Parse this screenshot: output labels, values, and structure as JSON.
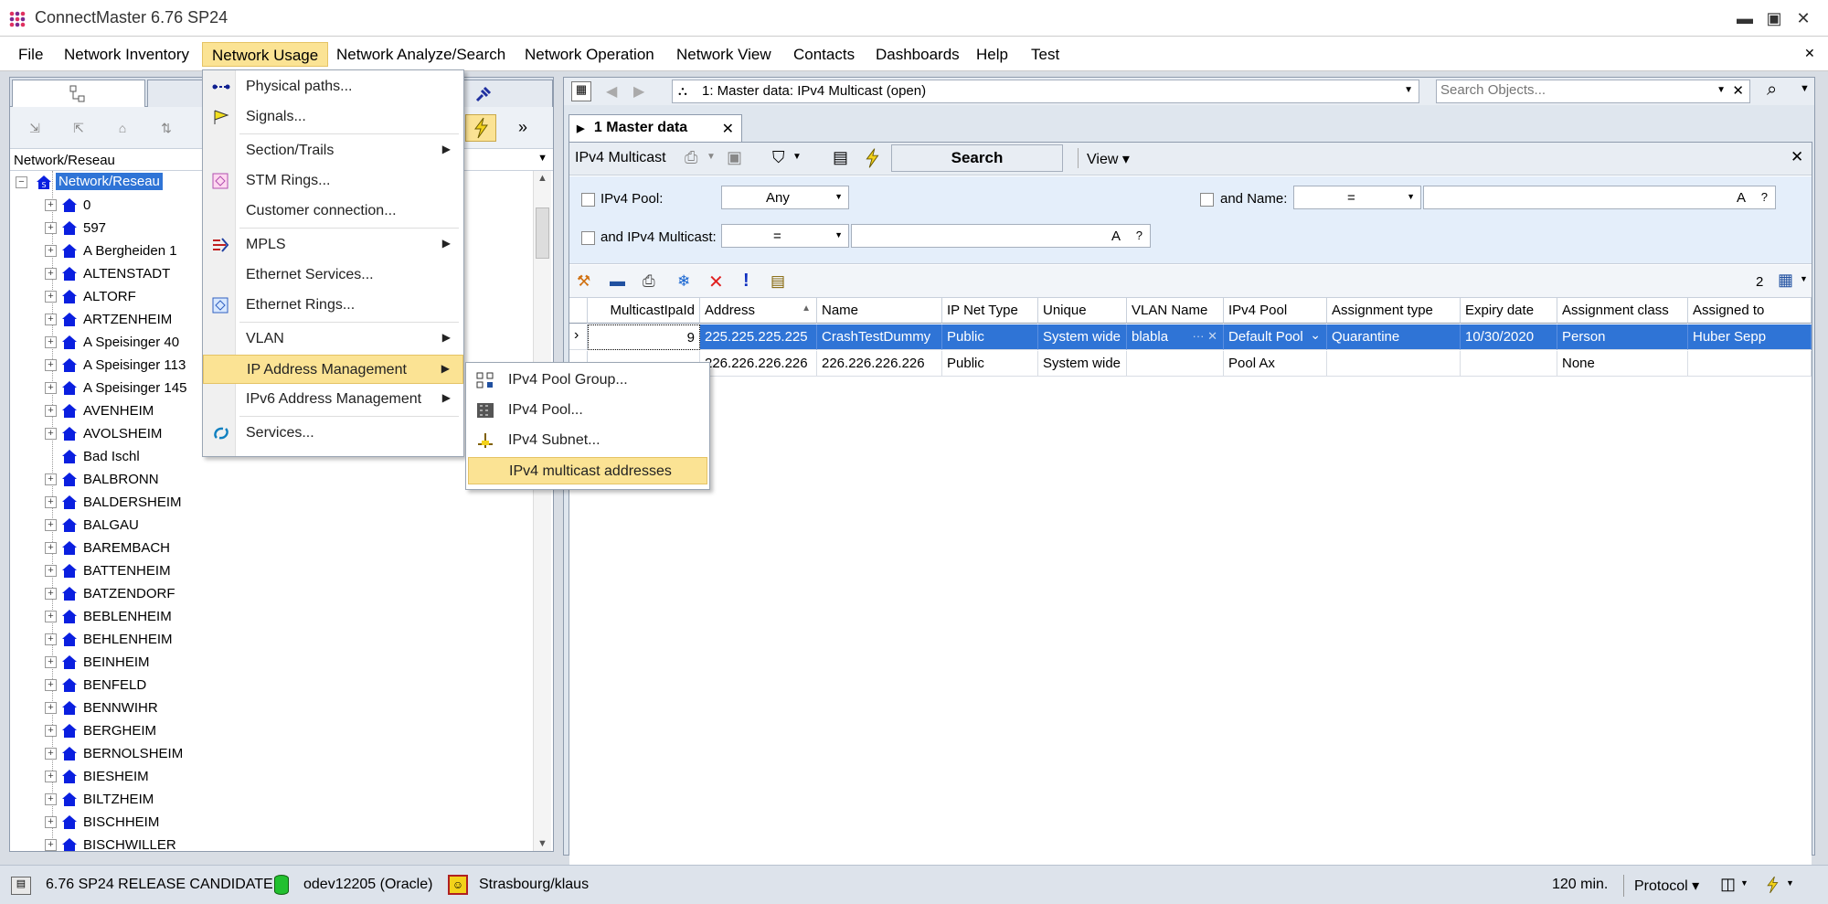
{
  "window": {
    "title": "ConnectMaster 6.76 SP24",
    "minimize": "▬",
    "maximize": "▣",
    "close": "✕"
  },
  "menu": [
    "File",
    "Network Inventory",
    "Network Usage",
    "Network Analyze/Search",
    "Network Operation",
    "Network View",
    "Contacts",
    "Dashboards",
    "Help",
    "Test"
  ],
  "menu_close": "✕",
  "left": {
    "path": "Network/Reseau",
    "more": "»",
    "tree_root": "Network/Reseau",
    "tree": [
      "0",
      "597",
      "A Bergheiden 1",
      "ALTENSTADT",
      "ALTORF",
      "ARTZENHEIM",
      "A Speisinger 40",
      "A Speisinger 113",
      "A Speisinger 145",
      "AVENHEIM",
      "AVOLSHEIM",
      "Bad Ischl",
      "BALBRONN",
      "BALDERSHEIM",
      "BALGAU",
      "BAREMBACH",
      "BATTENHEIM",
      "BATZENDORF",
      "BEBLENHEIM",
      "BEHLENHEIM",
      "BEINHEIM",
      "BENFELD",
      "BENNWIHR",
      "BERGHEIM",
      "BERNOLSHEIM",
      "BIESHEIM",
      "BILTZHEIM",
      "BISCHHEIM",
      "BISCHWILLER"
    ]
  },
  "network_usage_menu": [
    {
      "label": "Physical paths...",
      "sub": false
    },
    {
      "label": "Signals...",
      "sub": false
    },
    {
      "label": "Section/Trails",
      "sub": true
    },
    {
      "label": "STM Rings...",
      "sub": false
    },
    {
      "label": "Customer connection...",
      "sub": false
    },
    {
      "label": "MPLS",
      "sub": true
    },
    {
      "label": "Ethernet Services...",
      "sub": false
    },
    {
      "label": "Ethernet Rings...",
      "sub": false
    },
    {
      "label": "VLAN",
      "sub": true
    },
    {
      "label": "IP Address Management",
      "sub": true
    },
    {
      "label": "IPv6 Address Management",
      "sub": true
    },
    {
      "label": "Services...",
      "sub": false
    }
  ],
  "submenu_arrow": "▶",
  "ip_submenu": [
    "IPv4 Pool Group...",
    "IPv4 Pool...",
    "IPv4 Subnet...",
    "IPv4 multicast addresses"
  ],
  "right": {
    "object_combo": "1: Master data: IPv4 Multicast  (open)",
    "search_placeholder": "Search Objects...",
    "tab_label": "1 Master data",
    "tab_close": "✕",
    "entity": "IPv4 Multicast",
    "search_button": "Search",
    "view_button": "View ▾",
    "close_panel": "✕",
    "filters": {
      "pool_label": "IPv4 Pool:",
      "pool_value": "Any",
      "name_label": "and Name:",
      "name_op": "=",
      "mc_label": "and IPv4 Multicast:",
      "mc_op": "=",
      "text_btn": "A",
      "help_btn": "?"
    },
    "row_count": "2",
    "columns": [
      "MulticastIpaId",
      "Address",
      "Name",
      "IP Net Type",
      "Unique",
      "VLAN Name",
      "IPv4 Pool",
      "Assignment type",
      "Expiry date",
      "Assignment class",
      "Assigned to"
    ],
    "rows": [
      [
        "9",
        "225.225.225.225",
        "CrashTestDummy",
        "Public",
        "System wide",
        "blabla",
        "Default Pool",
        "Quarantine",
        "10/30/2020",
        "Person",
        "Huber Sepp"
      ],
      [
        "",
        "226.226.226.226",
        "226.226.226.226",
        "Public",
        "System wide",
        "",
        "Pool Ax",
        "",
        "",
        "None",
        ""
      ]
    ],
    "row_marker": "›"
  },
  "status": {
    "version": "6.76 SP24 RELEASE CANDIDATE",
    "db": "odev12205 (Oracle)",
    "user": "Strasbourg/klaus",
    "timeout": "120 min.",
    "protocol": "Protocol ▾"
  },
  "colors": {
    "menu_highlight": "#fbe394",
    "selection": "#2f74d6",
    "house": "#0a1fe0",
    "filter_bg": "#e4eefa"
  }
}
